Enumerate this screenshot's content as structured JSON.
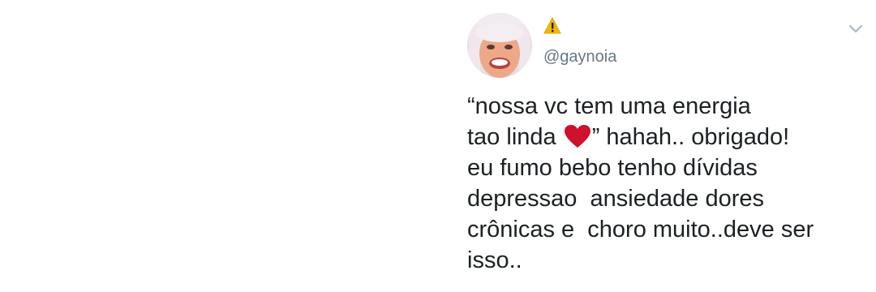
{
  "author": {
    "handle": "@gaynoia",
    "name_icon": "warning-icon",
    "avatar_icon": "avatar"
  },
  "menu": {
    "icon": "chevron-down-icon"
  },
  "tweet": {
    "line1": "“nossa vc tem uma energia",
    "line2_before": "tao linda ",
    "line2_after": "” hahah.. obrigado!",
    "line3": "eu fumo bebo tenho dívidas",
    "line4": "depressao  ansiedade dores",
    "line5": "crônicas e  choro muito..deve ser",
    "line6": "isso..",
    "emoji": "heart-emoji-icon"
  },
  "colors": {
    "text": "#1c2022",
    "secondary": "#657786",
    "heart": "#d0112b",
    "warning": "#f2b705",
    "background": "#ffffff"
  }
}
